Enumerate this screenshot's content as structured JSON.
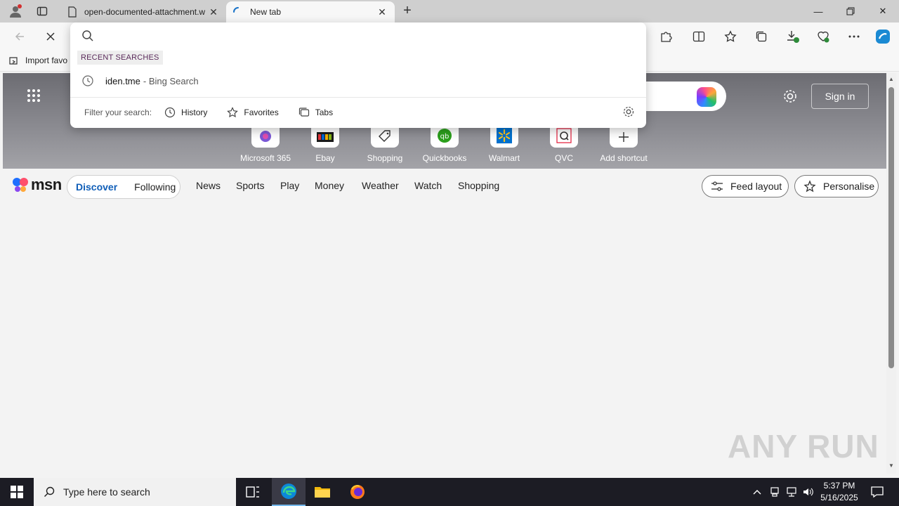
{
  "browser": {
    "tabs": [
      {
        "title": "open-documented-attachment.w",
        "active": false
      },
      {
        "title": "New tab",
        "active": true
      }
    ],
    "favorites_bar": {
      "import_label": "Import favo"
    }
  },
  "omnibox": {
    "recent_label": "RECENT SEARCHES",
    "recent": [
      {
        "query": "iden.tme",
        "source": "- Bing Search"
      }
    ],
    "filter_label": "Filter your search:",
    "filters": [
      {
        "label": "History",
        "icon": "history-icon"
      },
      {
        "label": "Favorites",
        "icon": "star-icon"
      },
      {
        "label": "Tabs",
        "icon": "tabs-icon"
      }
    ]
  },
  "hero": {
    "signin_label": "Sign in",
    "shortcuts": [
      {
        "label": "Microsoft 365",
        "icon": "m365-icon"
      },
      {
        "label": "Ebay",
        "icon": "ebay-icon"
      },
      {
        "label": "Shopping",
        "icon": "tag-icon"
      },
      {
        "label": "Quickbooks",
        "icon": "quickbooks-icon"
      },
      {
        "label": "Walmart",
        "icon": "walmart-icon"
      },
      {
        "label": "QVC",
        "icon": "qvc-icon"
      },
      {
        "label": "Add shortcut",
        "icon": "plus-icon"
      }
    ]
  },
  "msn": {
    "logo_text": "msn",
    "discover_label": "Discover",
    "following_label": "Following",
    "nav": [
      "News",
      "Sports",
      "Play",
      "Money",
      "Weather",
      "Watch",
      "Shopping"
    ],
    "feed_layout_label": "Feed layout",
    "personalise_label": "Personalise"
  },
  "watermark": "ANY RUN",
  "taskbar": {
    "search_placeholder": "Type here to search",
    "time": "5:37 PM",
    "date": "5/16/2025"
  },
  "colors": {
    "accent": "#0f5eb8",
    "taskbar": "#1c1c24",
    "edge_blue": "#0c88d8"
  }
}
